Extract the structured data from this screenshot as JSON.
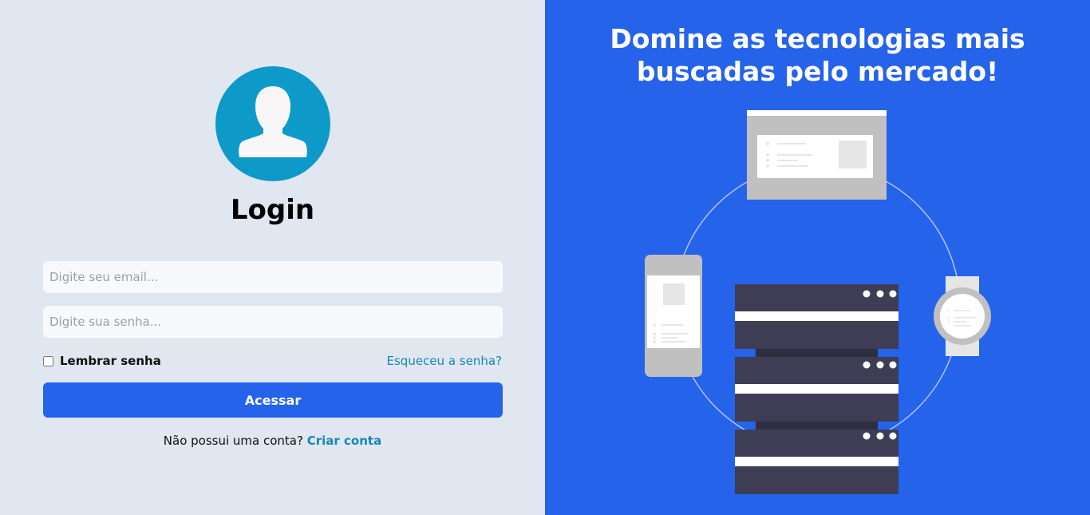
{
  "login": {
    "title": "Login",
    "email_placeholder": "Digite seu email...",
    "password_placeholder": "Digite sua senha...",
    "remember_label": "Lembrar senha",
    "forgot_label": "Esqueceu a senha?",
    "submit_label": "Acessar",
    "signup_prompt": "Não possui uma conta?",
    "signup_link": "Criar conta"
  },
  "promo": {
    "headline_part1": "Domine as ",
    "headline_bold1": "tecnologias mais",
    "headline_bold2": "buscadas",
    "headline_part2": " pelo mercado!"
  },
  "colors": {
    "left_bg": "#e0e7f0",
    "right_bg": "#2563eb",
    "avatar_bg": "#0e9ac9",
    "link": "#1a86b8",
    "server": "#3f3d56"
  },
  "icons": {
    "avatar": "user-silhouette-icon"
  }
}
